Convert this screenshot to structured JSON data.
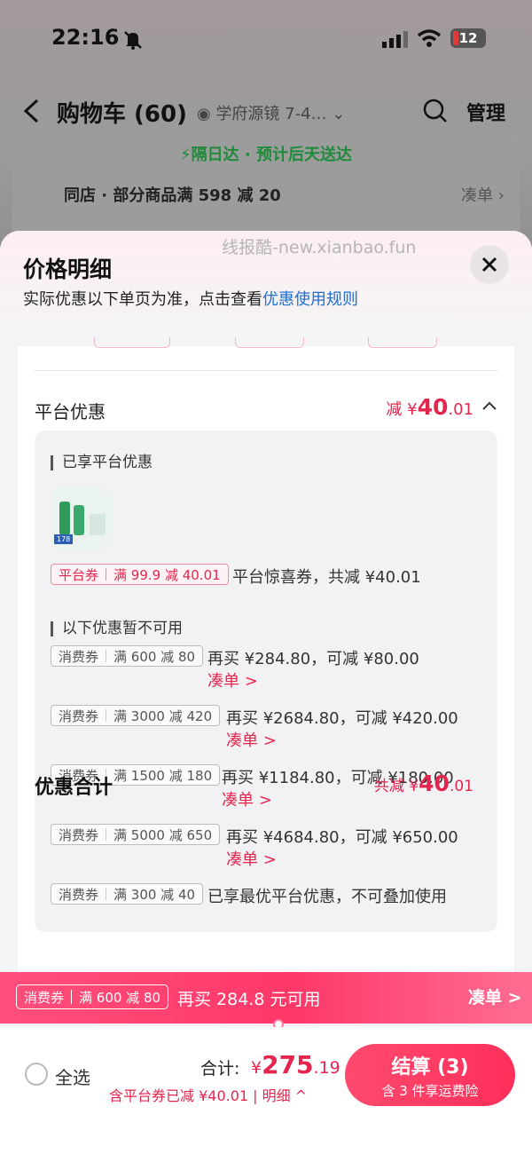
{
  "status_bar": {
    "time": "22:16",
    "battery": "12"
  },
  "navbar": {
    "title": "购物车 (60)",
    "address": "学府源镜 7-4…",
    "manage": "管理"
  },
  "cart": {
    "express": "隔日达 · 预计后天送达",
    "shop_promo": "同店 · 部分商品满 598 减 20",
    "shop_cou": "凑单"
  },
  "sheet": {
    "watermark": "线报酷-new.xianbao.fun",
    "title": "价格明细",
    "subtitle": "实际优惠以下单页为准，点击查看",
    "rules_link": "优惠使用规则",
    "platform": {
      "label": "平台优惠",
      "amount_prefix": "减 ¥",
      "amount_int": "40",
      "amount_dec": ".01",
      "enjoyed_header": "已享平台优惠",
      "enjoyed_tag_type": "平台券",
      "enjoyed_tag_rule": "满 99.9 减 40.01",
      "enjoyed_desc": "平台惊喜券，共减 ¥40.01",
      "unavailable_header": "以下优惠暂不可用",
      "unavailable": [
        {
          "type": "消费券",
          "rule": "满 600 减 80",
          "desc": "再买 ¥284.80，可减 ¥80.00",
          "cou": "凑单 >"
        },
        {
          "type": "消费券",
          "rule": "满 3000 减 420",
          "desc": "再买 ¥2684.80，可减 ¥420.00",
          "cou": "凑单 >"
        },
        {
          "type": "消费券",
          "rule": "满 1500 减 180",
          "desc": "再买 ¥1184.80，可减 ¥180.00",
          "cou": "凑单 >"
        },
        {
          "type": "消费券",
          "rule": "满 5000 减 650",
          "desc": "再买 ¥4684.80，可减 ¥650.00",
          "cou": "凑单 >"
        },
        {
          "type": "消费券",
          "rule": "满 300 减 40",
          "desc": "已享最优平台优惠，不可叠加使用"
        }
      ]
    },
    "total": {
      "label": "优惠合计",
      "prefix": "共减 ¥",
      "int": "40",
      "dec": ".01"
    }
  },
  "coupon_bar": {
    "type": "消费券",
    "rule": "满 600 减 80",
    "text": "再买 284.8 元可用",
    "cou": "凑单 >"
  },
  "bottom": {
    "select_all": "全选",
    "sum_label": "合计:",
    "sum_prefix": "¥",
    "sum_int": "275",
    "sum_dec": ".19",
    "sub": "含平台券已减 ¥40.01 | 明细 ^",
    "checkout_main": "结算 (3)",
    "checkout_sub": "含 3 件享运费险"
  },
  "colors": {
    "accent": "#e4264f",
    "express": "#1f8b3a",
    "link": "#1f6fd1"
  }
}
